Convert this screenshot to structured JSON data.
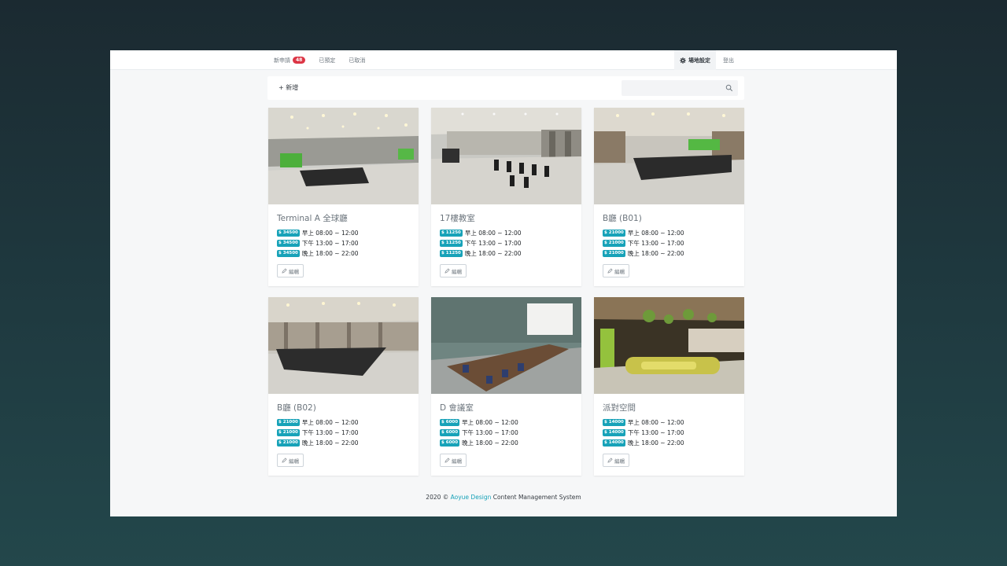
{
  "nav": {
    "new_requests_label": "新申請",
    "new_requests_count": "48",
    "booked_label": "已預定",
    "cancelled_label": "已取消",
    "settings_label": "場地設定",
    "logout_label": "登出"
  },
  "toolbar": {
    "add_label": "+ 新增",
    "search_placeholder": ""
  },
  "venues": [
    {
      "title": "Terminal A 全球廳",
      "slots": [
        {
          "price": "$ 34500",
          "label": "早上 08:00 ~ 12:00"
        },
        {
          "price": "$ 34500",
          "label": "下午 13:00 ~ 17:00"
        },
        {
          "price": "$ 34500",
          "label": "晚上 18:00 ~ 22:00"
        }
      ],
      "edit_label": "編輯"
    },
    {
      "title": "17樓教室",
      "slots": [
        {
          "price": "$ 11250",
          "label": "早上 08:00 ~ 12:00"
        },
        {
          "price": "$ 11250",
          "label": "下午 13:00 ~ 17:00"
        },
        {
          "price": "$ 11250",
          "label": "晚上 18:00 ~ 22:00"
        }
      ],
      "edit_label": "編輯"
    },
    {
      "title": "B廳 (B01)",
      "slots": [
        {
          "price": "$ 21000",
          "label": "早上 08:00 ~ 12:00"
        },
        {
          "price": "$ 21000",
          "label": "下午 13:00 ~ 17:00"
        },
        {
          "price": "$ 21000",
          "label": "晚上 18:00 ~ 22:00"
        }
      ],
      "edit_label": "編輯"
    },
    {
      "title": "B廳 (B02)",
      "slots": [
        {
          "price": "$ 21000",
          "label": "早上 08:00 ~ 12:00"
        },
        {
          "price": "$ 21000",
          "label": "下午 13:00 ~ 17:00"
        },
        {
          "price": "$ 21000",
          "label": "晚上 18:00 ~ 22:00"
        }
      ],
      "edit_label": "編輯"
    },
    {
      "title": "D 會議室",
      "slots": [
        {
          "price": "$ 6000",
          "label": "早上 08:00 ~ 12:00"
        },
        {
          "price": "$ 6000",
          "label": "下午 13:00 ~ 17:00"
        },
        {
          "price": "$ 6000",
          "label": "晚上 18:00 ~ 22:00"
        }
      ],
      "edit_label": "編輯"
    },
    {
      "title": "派對空間",
      "slots": [
        {
          "price": "$ 14000",
          "label": "早上 08:00 ~ 12:00"
        },
        {
          "price": "$ 14000",
          "label": "下午 13:00 ~ 17:00"
        },
        {
          "price": "$ 14000",
          "label": "晚上 18:00 ~ 22:00"
        }
      ],
      "edit_label": "編輯"
    }
  ],
  "footer": {
    "prefix": "2020 © ",
    "brand": "Aoyue Design",
    "suffix": " Content Management System"
  },
  "colors": {
    "accent": "#17a2b8",
    "badge": "#dc3545"
  },
  "icons": {
    "settings": "gear-icon",
    "search": "search-icon",
    "edit": "pencil-icon"
  }
}
